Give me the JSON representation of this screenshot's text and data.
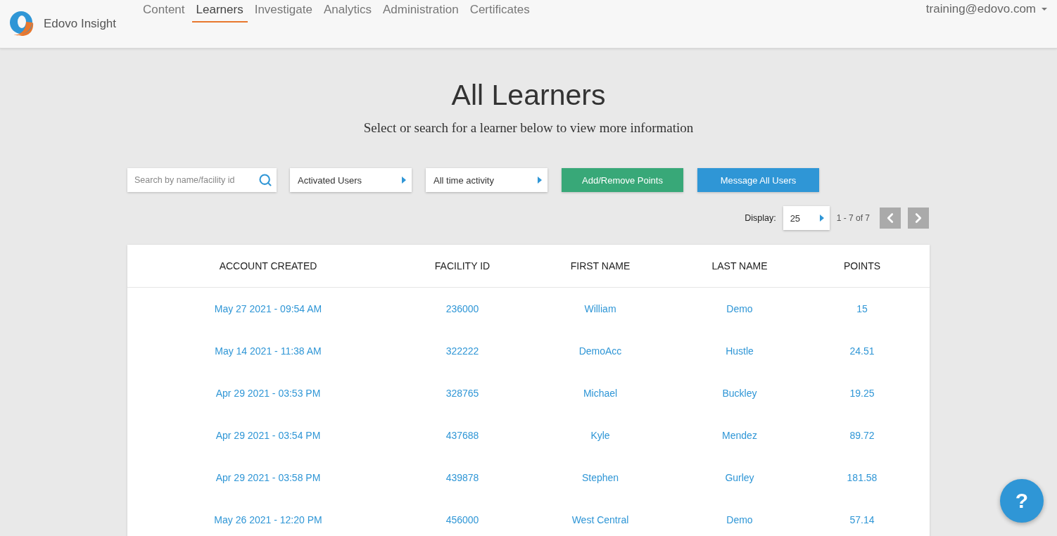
{
  "header": {
    "brand": "Edovo Insight",
    "nav": [
      {
        "label": "Content",
        "selected": false
      },
      {
        "label": "Learners",
        "selected": true
      },
      {
        "label": "Investigate",
        "selected": false
      },
      {
        "label": "Analytics",
        "selected": false
      },
      {
        "label": "Administration",
        "selected": false
      },
      {
        "label": "Certificates",
        "selected": false
      }
    ],
    "user": "training@edovo.com"
  },
  "page": {
    "title": "All Learners",
    "subtitle": "Select or search for a learner below to view more information"
  },
  "toolbar": {
    "search": {
      "placeholder": "Search by name/facility id"
    },
    "filters": [
      "Activated Users",
      "All time activity"
    ],
    "buttons": [
      {
        "label": "Add/Remove Points",
        "kind": "points"
      },
      {
        "label": "Message All Users",
        "kind": "message"
      }
    ]
  },
  "pagination": {
    "display_label": "Display:",
    "page_size": "25",
    "range": "1 - 7 of 7"
  },
  "table": {
    "columns": [
      "ACCOUNT CREATED",
      "FACILITY ID",
      "FIRST NAME",
      "LAST NAME",
      "POINTS"
    ],
    "rows": [
      [
        "May 27 2021 - 09:54 AM",
        "236000",
        "William",
        "Demo",
        "15"
      ],
      [
        "May 14 2021 - 11:38 AM",
        "322222",
        "DemoAcc",
        "Hustle",
        "24.51"
      ],
      [
        "Apr 29 2021 - 03:53 PM",
        "328765",
        "Michael",
        "Buckley",
        "19.25"
      ],
      [
        "Apr 29 2021 - 03:54 PM",
        "437688",
        "Kyle",
        "Mendez",
        "89.72"
      ],
      [
        "Apr 29 2021 - 03:58 PM",
        "439878",
        "Stephen",
        "Gurley",
        "181.58"
      ],
      [
        "May 26 2021 - 12:20 PM",
        "456000",
        "West Central",
        "Demo",
        "57.14"
      ]
    ]
  },
  "help": {
    "label": "?"
  }
}
